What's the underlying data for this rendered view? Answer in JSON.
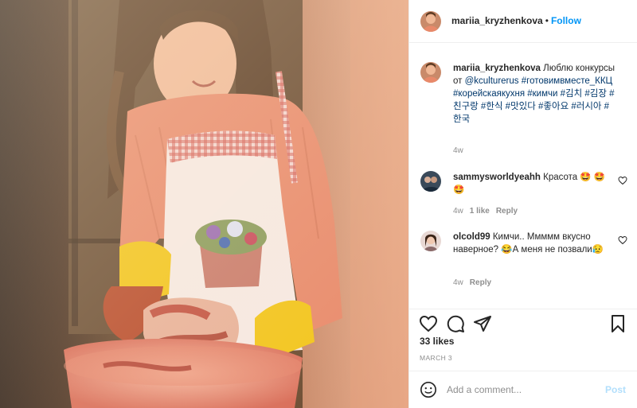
{
  "post": {
    "username": "mariia_kryzhenkova",
    "separator": "•",
    "follow_label": "Follow"
  },
  "caption": {
    "username": "mariia_kryzhenkova",
    "text_1": " Люблю конкурсы от ",
    "mention": "@kculturerus",
    "hashtags": "#готовимвместе_ККЦ #корейскаякухня #кимчи #김치 #김장 #친구랑 #한식 #맛있다 #좋아요 #러시아 #한국",
    "time": "4w"
  },
  "comments": [
    {
      "username": "sammysworldyeahh",
      "text": " Красота 🤩 🤩🤩",
      "time": "4w",
      "likes": "1 like",
      "reply": "Reply"
    },
    {
      "username": "olcold99",
      "text": " Кимчи.. Ммммм вкусно наверное? 😂А меня не позвали😥",
      "time": "4w",
      "reply": "Reply"
    }
  ],
  "likes_count": "33 likes",
  "post_date": "MARCH 3",
  "add_comment": {
    "placeholder": "Add a comment...",
    "post_label": "Post"
  },
  "colors": {
    "link_blue": "#0095f6",
    "mention_blue": "#00376b",
    "muted_gray": "#8e8e8e",
    "post_disabled": "#b2dffc",
    "sweater_coral": "#e8896a",
    "glove_yellow": "#f2c419"
  },
  "icons": [
    "heart-icon",
    "comment-icon",
    "share-icon",
    "bookmark-icon",
    "emoji-icon",
    "like-heart-icon"
  ]
}
